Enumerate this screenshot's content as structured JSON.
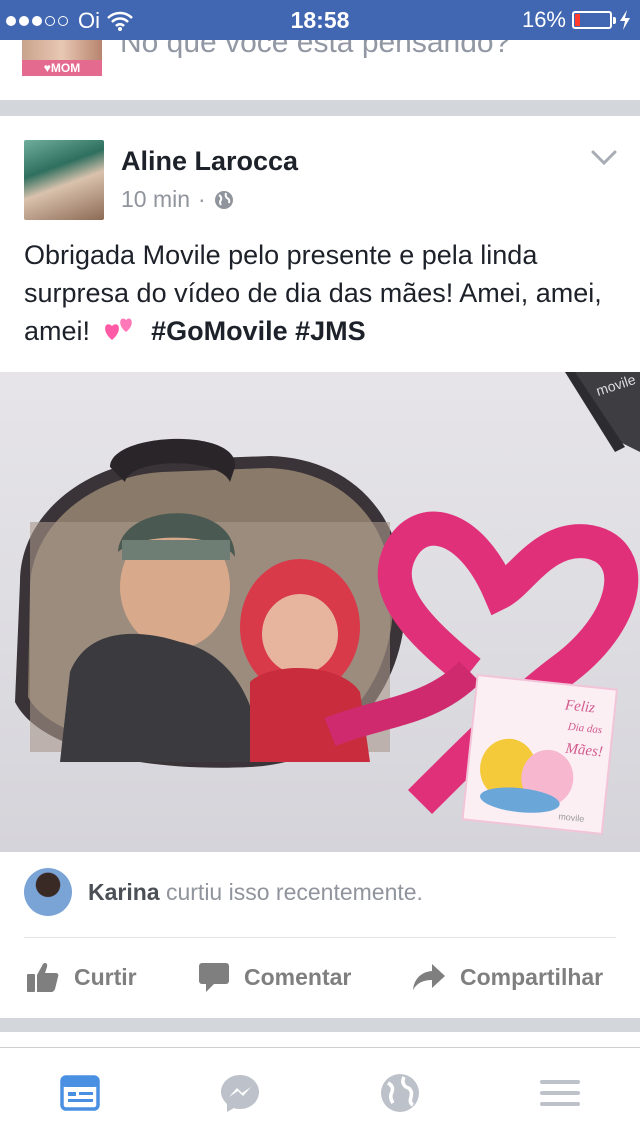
{
  "status_bar": {
    "carrier": "Oi",
    "time": "18:58",
    "battery_percent": "16%",
    "battery_level": 0.16,
    "signal_bars_filled": 3,
    "signal_bars_total": 5
  },
  "composer": {
    "placeholder": "No que você está pensando?",
    "avatar_badge": "MOM"
  },
  "post": {
    "author": "Aline Larocca",
    "time_ago": "10 min",
    "meta_separator": "·",
    "privacy_icon": "globe-icon",
    "text": "Obrigada Movile pelo presente e pela linda surpresa do vídeo de dia das mães! Amei, amei, amei!",
    "hashtags": [
      "#GoMovile",
      "#JMS"
    ],
    "photo": {
      "box_label": "movile",
      "card_text": [
        "Feliz",
        "Dia das",
        "Mães!"
      ],
      "card_brand": "movile"
    }
  },
  "likes": {
    "name": "Karina",
    "text": "curtiu isso recentemente."
  },
  "actions": {
    "like": "Curtir",
    "comment": "Comentar",
    "share": "Compartilhar"
  },
  "bottom_nav": [
    "news-feed-icon",
    "messenger-icon",
    "globe-icon",
    "menu-icon"
  ],
  "colors": {
    "brand_blue": "#4267b2",
    "text": "#1d2129",
    "muted": "#90949c",
    "battery_low": "#ff3b30",
    "active_tab": "#4a90e2",
    "inactive_icon": "#bdc1c9"
  }
}
